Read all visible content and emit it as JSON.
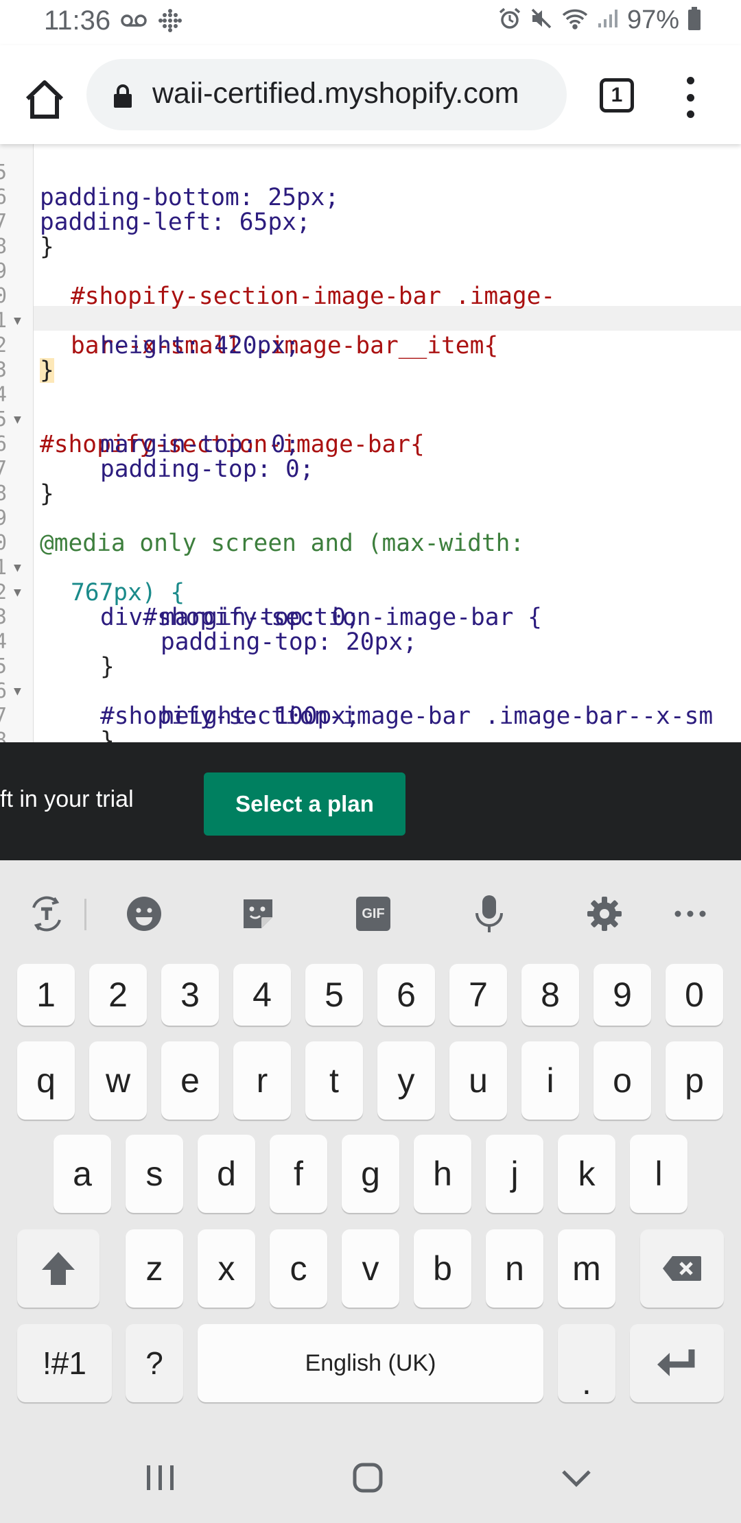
{
  "status_bar": {
    "time": "11:36",
    "battery_percent": "97%"
  },
  "browser": {
    "url": "waii-certified.myshopify.com",
    "tab_count": "1"
  },
  "editor": {
    "lines": [
      {
        "n": "5",
        "text": "padding-bottom: 25px;"
      },
      {
        "n": "6",
        "text": "padding-left: 65px;"
      },
      {
        "n": "7",
        "text": "}"
      },
      {
        "n": "8",
        "text": ""
      },
      {
        "n": "9",
        "text": "#shopify-section-image-bar .image-"
      },
      {
        "n": "0",
        "text": "bar--x-small .image-bar__item{"
      },
      {
        "n": "1",
        "text": "height: 420px;"
      },
      {
        "n": "2",
        "text": "}"
      },
      {
        "n": "3",
        "text": ""
      },
      {
        "n": "4",
        "text": "#shopify-section-image-bar{"
      },
      {
        "n": "5",
        "text": "margin-top: 0;"
      },
      {
        "n": "6",
        "text": "padding-top: 0;"
      },
      {
        "n": "7",
        "text": "}"
      },
      {
        "n": "8",
        "text": ""
      },
      {
        "n": "9",
        "text": "@media only screen and (max-width:"
      },
      {
        "n": "0",
        "text": "767px) {"
      },
      {
        "n": "1",
        "text": "div#shopify-section-image-bar {"
      },
      {
        "n": "2",
        "text": "margin-top: 0;"
      },
      {
        "n": "3",
        "text": "padding-top: 20px;"
      },
      {
        "n": "4",
        "text": "}"
      },
      {
        "n": "5",
        "text": "#shopify-section-image-bar .image-bar--x-sm"
      },
      {
        "n": "6",
        "text": "height: 100px;"
      },
      {
        "n": "7",
        "text": "}"
      },
      {
        "n": "8",
        "text": "}"
      }
    ]
  },
  "trial_banner": {
    "text": "ft in your trial",
    "button": "Select a plan"
  },
  "keyboard": {
    "toolbar_icons": [
      "translate-icon",
      "emoji-icon",
      "sticker-icon",
      "gif-icon",
      "microphone-icon",
      "settings-icon",
      "more-icon"
    ],
    "gif_label": "GIF",
    "row_numbers": [
      "1",
      "2",
      "3",
      "4",
      "5",
      "6",
      "7",
      "8",
      "9",
      "0"
    ],
    "row1": [
      "q",
      "w",
      "e",
      "r",
      "t",
      "y",
      "u",
      "i",
      "o",
      "p"
    ],
    "row2": [
      "a",
      "s",
      "d",
      "f",
      "g",
      "h",
      "j",
      "k",
      "l"
    ],
    "row3": [
      "z",
      "x",
      "c",
      "v",
      "b",
      "n",
      "m"
    ],
    "symbols_key": "!#1",
    "question_key": "?",
    "space_label": "English (UK)",
    "period_key": "."
  },
  "colors": {
    "accent_button": "#008060",
    "banner_bg": "#202223",
    "keyboard_bg": "#e8e8e8"
  }
}
